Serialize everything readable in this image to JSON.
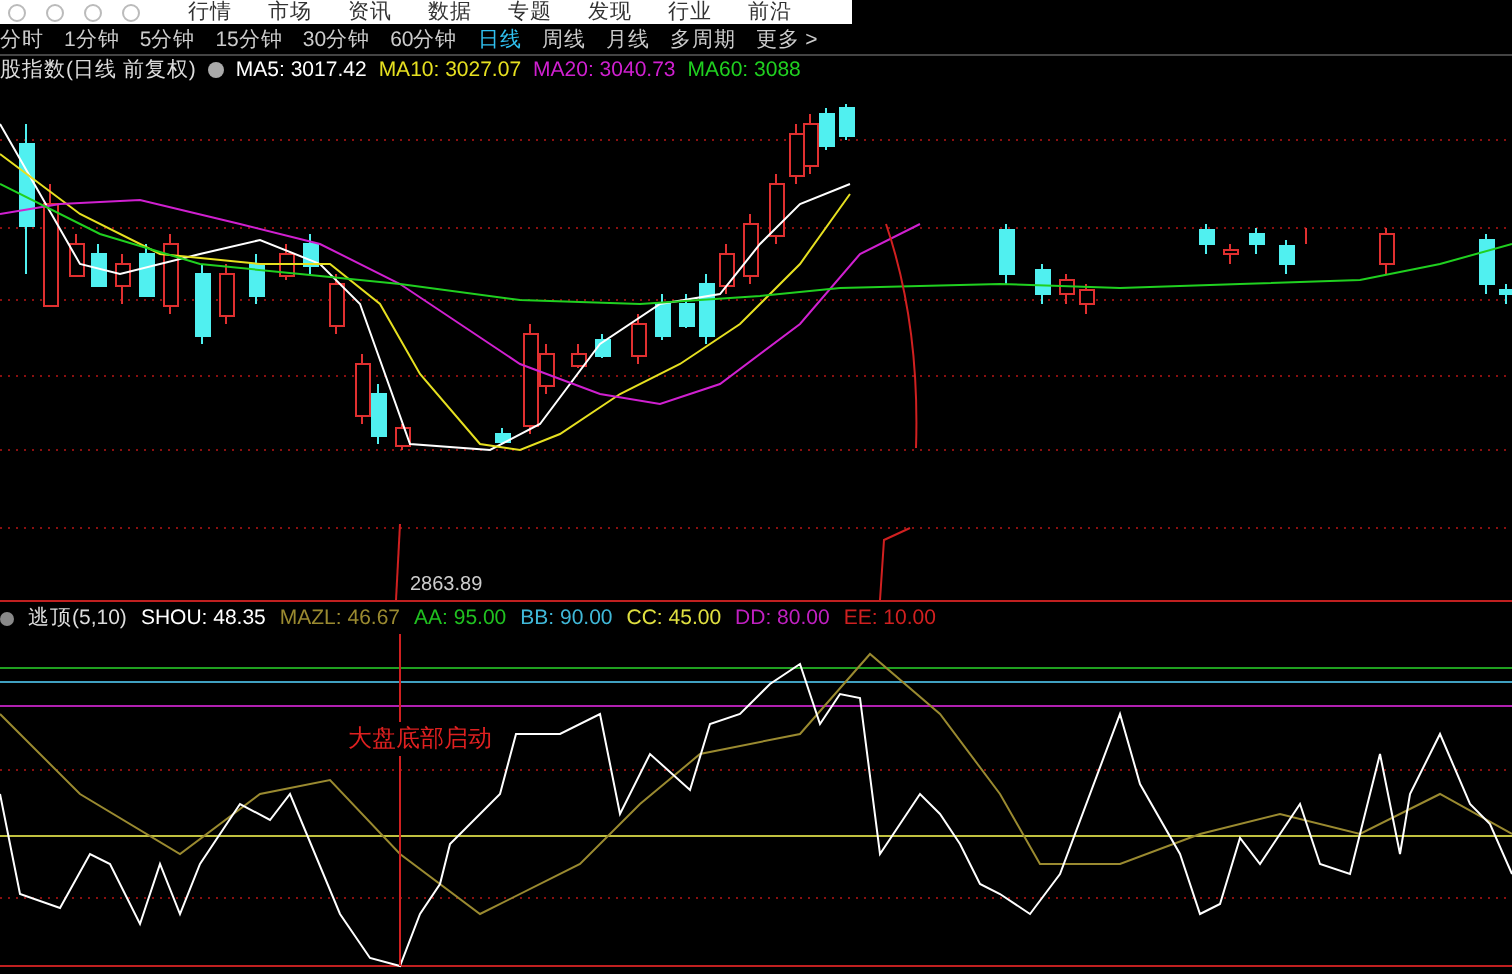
{
  "toolbar": {
    "menu": [
      "行情",
      "市场",
      "资讯",
      "数据",
      "专题",
      "发现",
      "行业",
      "前沿"
    ]
  },
  "periods": [
    {
      "label": "分时",
      "selected": false
    },
    {
      "label": "1分钟",
      "selected": false
    },
    {
      "label": "5分钟",
      "selected": false
    },
    {
      "label": "15分钟",
      "selected": false
    },
    {
      "label": "30分钟",
      "selected": false
    },
    {
      "label": "60分钟",
      "selected": false
    },
    {
      "label": "日线",
      "selected": true
    },
    {
      "label": "周线",
      "selected": false
    },
    {
      "label": "月线",
      "selected": false
    },
    {
      "label": "多周期",
      "selected": false
    },
    {
      "label": "更多 >",
      "selected": false
    }
  ],
  "main_chart": {
    "title": "股指数(日线 前复权)",
    "indicators": [
      {
        "label": "MA5: 3017.42",
        "color": "#ffffff"
      },
      {
        "label": "MA10: 3027.07",
        "color": "#e6e020"
      },
      {
        "label": "MA20: 3040.73",
        "color": "#d020d0"
      },
      {
        "label": "MA60: 3088",
        "color": "#20d020"
      }
    ],
    "low_label": "2863.89"
  },
  "indicator_chart": {
    "title": "逃顶(5,10)",
    "values": [
      {
        "label": "SHOU: 48.35",
        "color": "#ffffff"
      },
      {
        "label": "MAZL: 46.67",
        "color": "#9a8a30"
      },
      {
        "label": "AA: 95.00",
        "color": "#20c020"
      },
      {
        "label": "BB: 90.00",
        "color": "#40b8d8"
      },
      {
        "label": "CC: 45.00",
        "color": "#e0e040"
      },
      {
        "label": "DD: 80.00",
        "color": "#c020c0"
      },
      {
        "label": "EE: 10.00",
        "color": "#d02020"
      }
    ],
    "annotation": "大盘底部启动"
  }
}
